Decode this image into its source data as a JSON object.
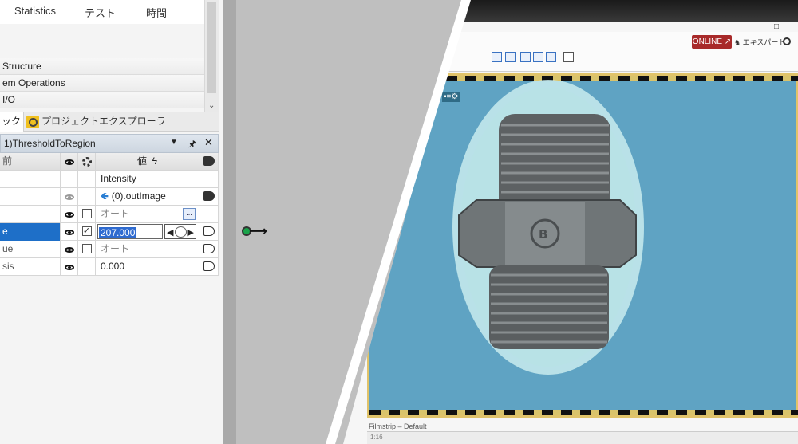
{
  "left_panel": {
    "top_tabs": [
      "Statistics",
      "テスト",
      "時間"
    ],
    "categories": [
      "Structure",
      "em Operations",
      "I/O"
    ],
    "dock_tabs": {
      "toolbox": "ックス",
      "explorer": "プロジェクトエクスプローラ"
    },
    "filter": {
      "title": "1)ThresholdToRegion",
      "columns": {
        "name": "前",
        "value": "値"
      },
      "rows": [
        {
          "name": "",
          "value": "Intensity"
        },
        {
          "name": "",
          "value": "(0).outImage"
        },
        {
          "name": "",
          "value": "オート",
          "button": "..."
        },
        {
          "name": "e",
          "value": "207.000"
        },
        {
          "name": "ue",
          "value": "オート"
        },
        {
          "name": "sis",
          "value": "0.000"
        }
      ]
    }
  },
  "right_app": {
    "online_label": "ONLINE",
    "expert_label": "エキスパート",
    "filmstrip_label": "Filmstrip – Default",
    "bottom_text": "1:16"
  },
  "colors": {
    "selection": "#1e6fc8",
    "viewer_bg": "#5fa3c3",
    "online": "#a82a2a",
    "film_frame": "#e0c36a"
  }
}
